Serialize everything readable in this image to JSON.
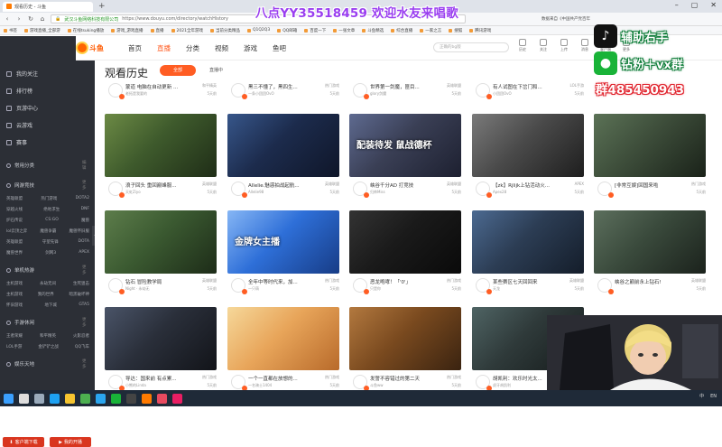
{
  "browser": {
    "tab_title": "观看历史 - 斗鱼",
    "address_site": "武汉斗鱼网络科技有限公司",
    "url": "https://www.douyu.com/directory/watchHistory",
    "bookmarks": [
      "书签",
      "游戏直播_全部游",
      "在线tsuking播放",
      "游戏_游戏直播",
      "直播",
      "2021全年游戏",
      "当前分类精品",
      "Q1Q2Q3",
      "QQ邮箱",
      "百度一下",
      "一张文章",
      "斗鱼精选",
      "综合直播",
      "一家之言",
      "搜狐",
      "腾讯游戏"
    ],
    "right_text": "数据来自《中国共产党百年"
  },
  "header": {
    "logo_text": "斗鱼",
    "nav": [
      "首页",
      "直播",
      "分类",
      "视频",
      "游戏",
      "鱼吧"
    ],
    "active_nav": "直播",
    "search_placeholder": "正确的bg版",
    "icons": [
      {
        "name": "history-icon",
        "label": "历史"
      },
      {
        "name": "follow-icon",
        "label": "关注"
      },
      {
        "name": "upload-icon",
        "label": "上传"
      },
      {
        "name": "message-icon",
        "label": "消息"
      },
      {
        "name": "client-icon",
        "label": "客户端"
      },
      {
        "name": "more-icon",
        "label": "更多"
      }
    ]
  },
  "sidebar": {
    "items": [
      {
        "label": "我的关注",
        "icon": "heart-icon"
      },
      {
        "label": "排行榜",
        "icon": "rank-icon"
      },
      {
        "label": "页游中心",
        "icon": "game-icon"
      },
      {
        "label": "云游戏",
        "icon": "cloud-icon"
      },
      {
        "label": "赛事",
        "icon": "trophy-icon"
      }
    ],
    "sections": [
      {
        "title": "常用分类",
        "more": "编辑",
        "rows": []
      },
      {
        "title": "网游竞技",
        "more": "更多",
        "rows": [
          [
            "英雄联盟",
            "热门游戏",
            "DOTA2"
          ],
          [
            "穿越火线",
            "绝地求生",
            "DNF"
          ],
          [
            "炉石传说",
            "CS:GO",
            "魔兽"
          ],
          [
            "lol云顶之弈",
            "魔兽争霸",
            "魔兽怀旧服"
          ],
          [
            "英雄联盟",
            "守望先锋",
            "DOTA"
          ],
          [
            "魔兽世界",
            "剑网3",
            "APEX"
          ]
        ]
      },
      {
        "title": "单机热游",
        "more": "更多",
        "rows": [
          [
            "主机游戏",
            "永劫无间",
            "生死狙击"
          ],
          [
            "主机游戏",
            "我的世界",
            "暗黑破坏神"
          ],
          [
            "怀旧游戏",
            "地下城",
            "GTA5"
          ]
        ]
      },
      {
        "title": "手游休闲",
        "more": "更多",
        "rows": [
          [
            "王者荣耀",
            "和平精英",
            "火影忍者"
          ],
          [
            "LOL手游",
            "金铲铲之战",
            "QQ飞车"
          ]
        ]
      },
      {
        "title": "娱乐天地",
        "more": "更多",
        "rows": []
      }
    ],
    "buttons": [
      "客户端下载",
      "我的开播"
    ]
  },
  "content": {
    "title": "观看历史",
    "filters": [
      "全部",
      "直播中"
    ],
    "partial_row": [
      {
        "title": "蒙道 电脑在自动更新 ...",
        "sub": "老拓是我要的",
        "cat": "和平精英",
        "time": "5天前"
      },
      {
        "title": "黑三不懂了，黑四生...",
        "sub": "一条小团团OvO",
        "cat": "热门游戏",
        "time": "5天前"
      },
      {
        "title": "世界第一剑魔，匪目...",
        "sub": "glory剑魔",
        "cat": "英雄联盟",
        "time": "5天前"
      },
      {
        "title": "有人试图在下岔门和...",
        "sub": "小团团OvO",
        "cat": "LOL手游",
        "time": "5天前"
      },
      {
        "title": "",
        "sub": "",
        "cat": "",
        "time": ""
      },
      {
        "title": "",
        "sub": "",
        "cat": "",
        "time": ""
      }
    ],
    "cards": [
      {
        "title": "浪子回头 重回巅峰服...",
        "sub": "天虹Ziyo",
        "cat": "英雄联盟",
        "time": "5天前"
      },
      {
        "title": "Allelie.魅惑拍战起航...",
        "sub": "Allelie98",
        "cat": "英雄联盟",
        "time": "5天前"
      },
      {
        "title": "峡谷千分AD 打竞技",
        "sub": "归帅Miss",
        "cat": "英雄联盟",
        "time": "5天前"
      },
      {
        "title": "【zk】Rjlijk上钻活动火...",
        "sub": "Apex28",
        "cat": "APEX",
        "time": "5天前"
      },
      {
        "title": "[非常互娱]回国来啦",
        "sub": "",
        "cat": "热门游戏",
        "time": "5天前"
      },
      {
        "title": "",
        "sub": "",
        "cat": "",
        "time": ""
      },
      {
        "title": "钻石 冒险教学局",
        "sub": "Night · 永劫无",
        "cat": "英雄联盟",
        "time": "5天前"
      },
      {
        "title": "全年中等时代来，加...",
        "sub": "一只萌",
        "cat": "热门游戏",
        "time": "5天前"
      },
      {
        "title": "恶龙咆哮！「'0'」",
        "sub": "只是你",
        "cat": "热门游戏",
        "time": "5天前"
      },
      {
        "title": "某些赛区七天回回来",
        "sub": "天龙",
        "cat": "英雄联盟",
        "time": "5天前"
      },
      {
        "title": "峡谷之巅前永上钻石!",
        "sub": "",
        "cat": "英雄联盟",
        "time": "5天前"
      },
      {
        "title": "",
        "sub": "",
        "cat": "",
        "time": ""
      },
      {
        "title": "导达：国来前 有点累...",
        "sub": "小熊的Linda",
        "cat": "热门游戏",
        "time": "5天前"
      },
      {
        "title": "一个一直都在放想的...",
        "sub": "一名骑士1404",
        "cat": "热门游戏",
        "time": "5天前"
      },
      {
        "title": "发誓不容错过的第二天",
        "sub": "斗鱼ww",
        "cat": "热门游戏",
        "time": "5天前"
      },
      {
        "title": "胡凯利：欢乐时光太...",
        "sub": "虎牙胡凯利",
        "cat": "热门游戏",
        "time": "5天前"
      },
      {
        "title": "",
        "sub": "",
        "cat": "",
        "time": ""
      },
      {
        "title": "",
        "sub": "",
        "cat": "",
        "time": ""
      }
    ],
    "thumb_colors": [
      [
        "#3e5a2c",
        "#1f2d17",
        "#6c8a45"
      ],
      [
        "#1c2b4c",
        "#0f1629",
        "#37568a"
      ],
      [
        "#3a3f55",
        "#1d2030",
        "#5e6a90"
      ],
      [
        "#4a4a4a",
        "#1e1e1e",
        "#7a7a7a"
      ],
      [
        "#3d4d3a",
        "#1a2219",
        "#5b7256"
      ],
      [
        "#ffffff",
        "#ffffff",
        "#ffffff"
      ],
      [
        "#3b5a31",
        "#1d2c18",
        "#5d7d4b"
      ],
      [
        "#2e6fd8",
        "#173c86",
        "#86b6f5"
      ],
      [
        "#1a1a1a",
        "#0a0a0a",
        "#333333"
      ],
      [
        "#2c3d54",
        "#141d2a",
        "#4c6a91"
      ],
      [
        "#3a4a3c",
        "#1b221c",
        "#5c6f5d"
      ],
      [
        "#ffffff",
        "#ffffff",
        "#ffffff"
      ],
      [
        "#2a2f3a",
        "#121419",
        "#4a5468"
      ],
      [
        "#e8a55a",
        "#b86a2a",
        "#f6d89a"
      ],
      [
        "#7a4a1f",
        "#3a2310",
        "#b3793f"
      ],
      [
        "#2f3a3a",
        "#151b1b",
        "#4f6464"
      ],
      [
        "#ffffff",
        "#ffffff",
        "#ffffff"
      ],
      [
        "#ffffff",
        "#ffffff",
        "#ffffff"
      ]
    ],
    "thumb_captions": [
      "",
      "",
      "配装待发 鼠战德杯",
      "",
      "",
      "",
      "",
      "金牌女主播",
      "",
      "",
      "",
      "",
      "",
      "",
      "",
      "",
      "",
      ""
    ]
  },
  "overlays": {
    "title": "八点YY35518459 欢迎水友来唱歌",
    "tiktok_text": "辅助右手",
    "wechat_text": "钻粉＋vx群",
    "group_text": "群485450943",
    "colors": {
      "purple": "#9a3ef0",
      "green": "#0a7a35",
      "red": "#e0212b",
      "accent": "#ff5d23"
    }
  },
  "taskbar": {
    "icons": [
      "windows-icon",
      "search-icon",
      "taskview-icon",
      "edge-icon",
      "explorer-icon",
      "chrome-icon",
      "qq-icon",
      "wechat-icon",
      "obs-icon",
      "douyu-icon",
      "game-icon",
      "music-icon"
    ],
    "tray": [
      "中",
      "EN"
    ]
  }
}
